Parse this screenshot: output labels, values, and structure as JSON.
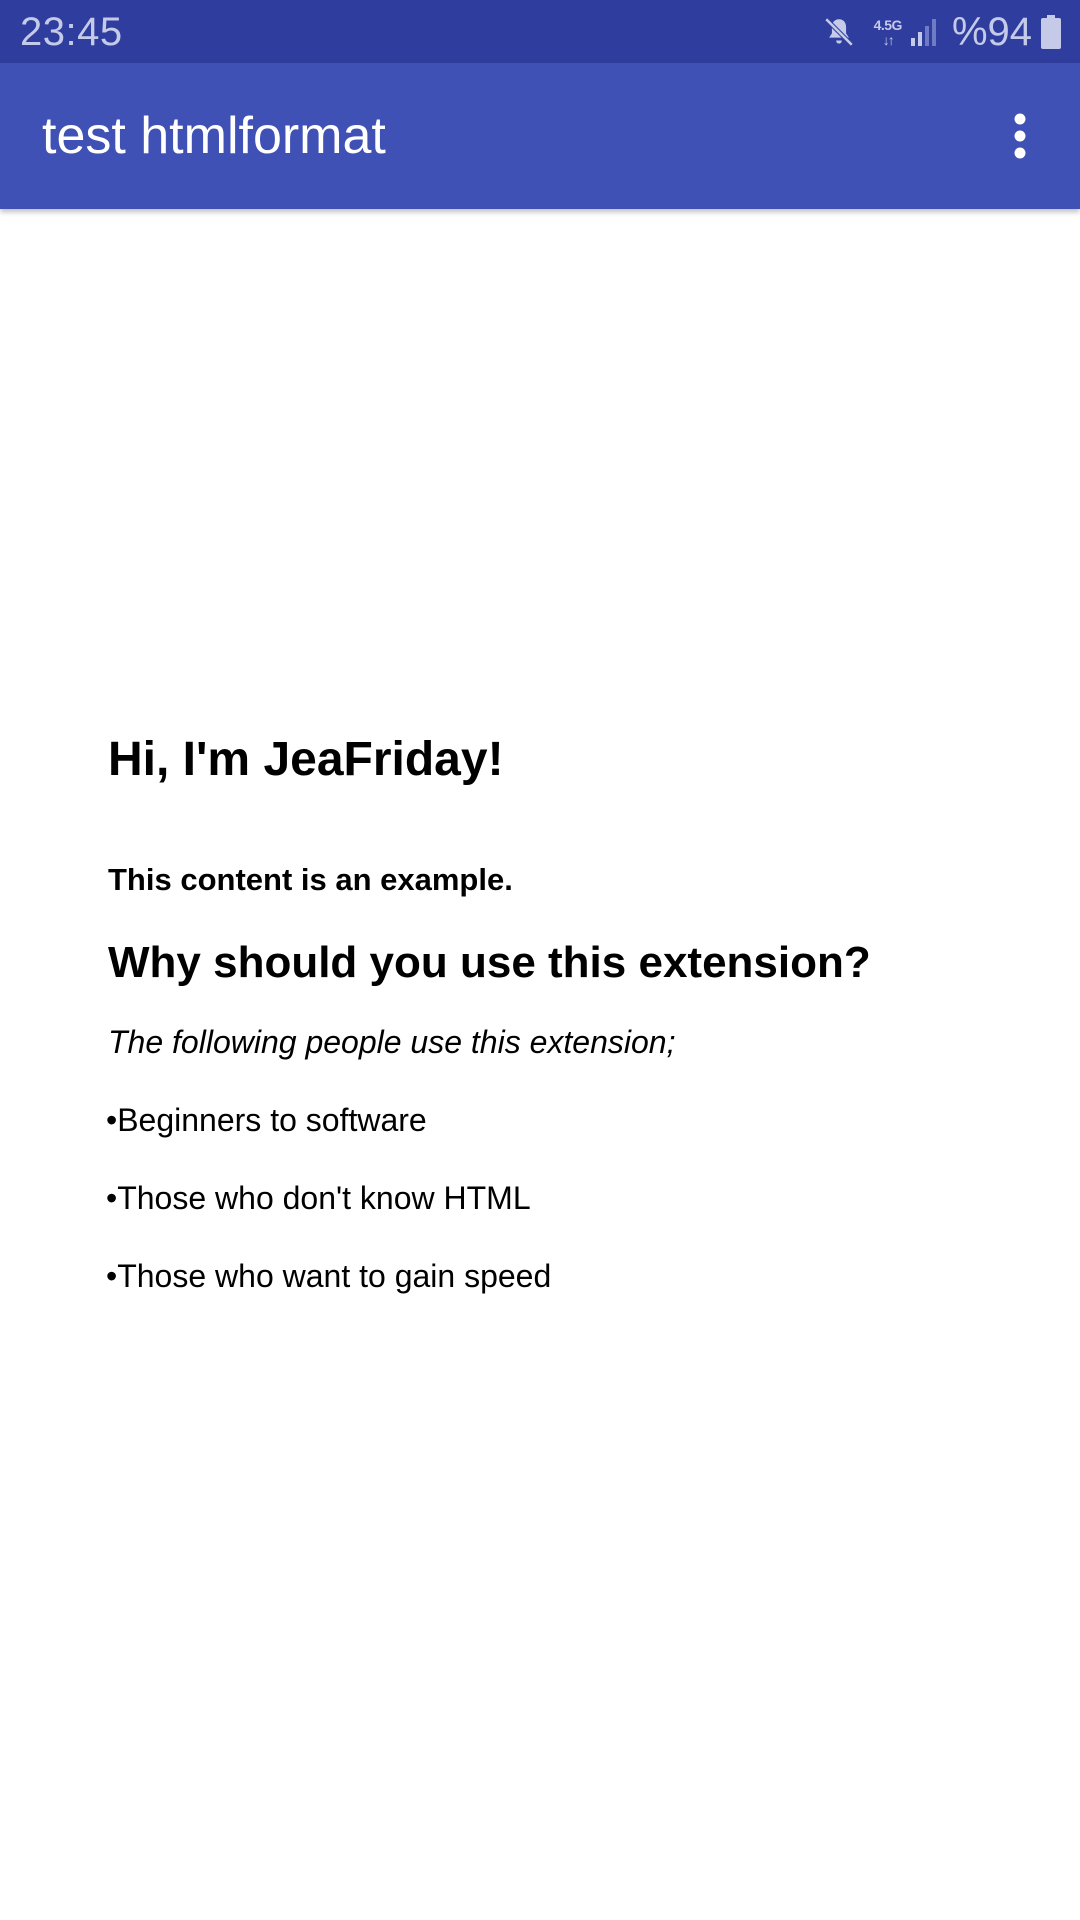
{
  "status_bar": {
    "time": "23:45",
    "network_label": "4.5G",
    "network_arrows": "↓↑",
    "battery_percent": "%94",
    "icons": [
      "mute-icon",
      "network-icon",
      "signal-icon",
      "battery-icon"
    ],
    "background_color": "#2f3d9e"
  },
  "app_bar": {
    "title": "test htmlformat",
    "overflow_icon": "more-vert-icon",
    "background_color": "#3f51b5"
  },
  "content": {
    "heading": "Hi, I'm JeaFriday!",
    "intro": "This content is an example.",
    "subheading": "Why should you use this extension?",
    "lead": "The following people use this extension;",
    "bullets": [
      "•Beginners to software",
      "•Those who don't know HTML",
      "•Those who want to gain speed"
    ]
  }
}
